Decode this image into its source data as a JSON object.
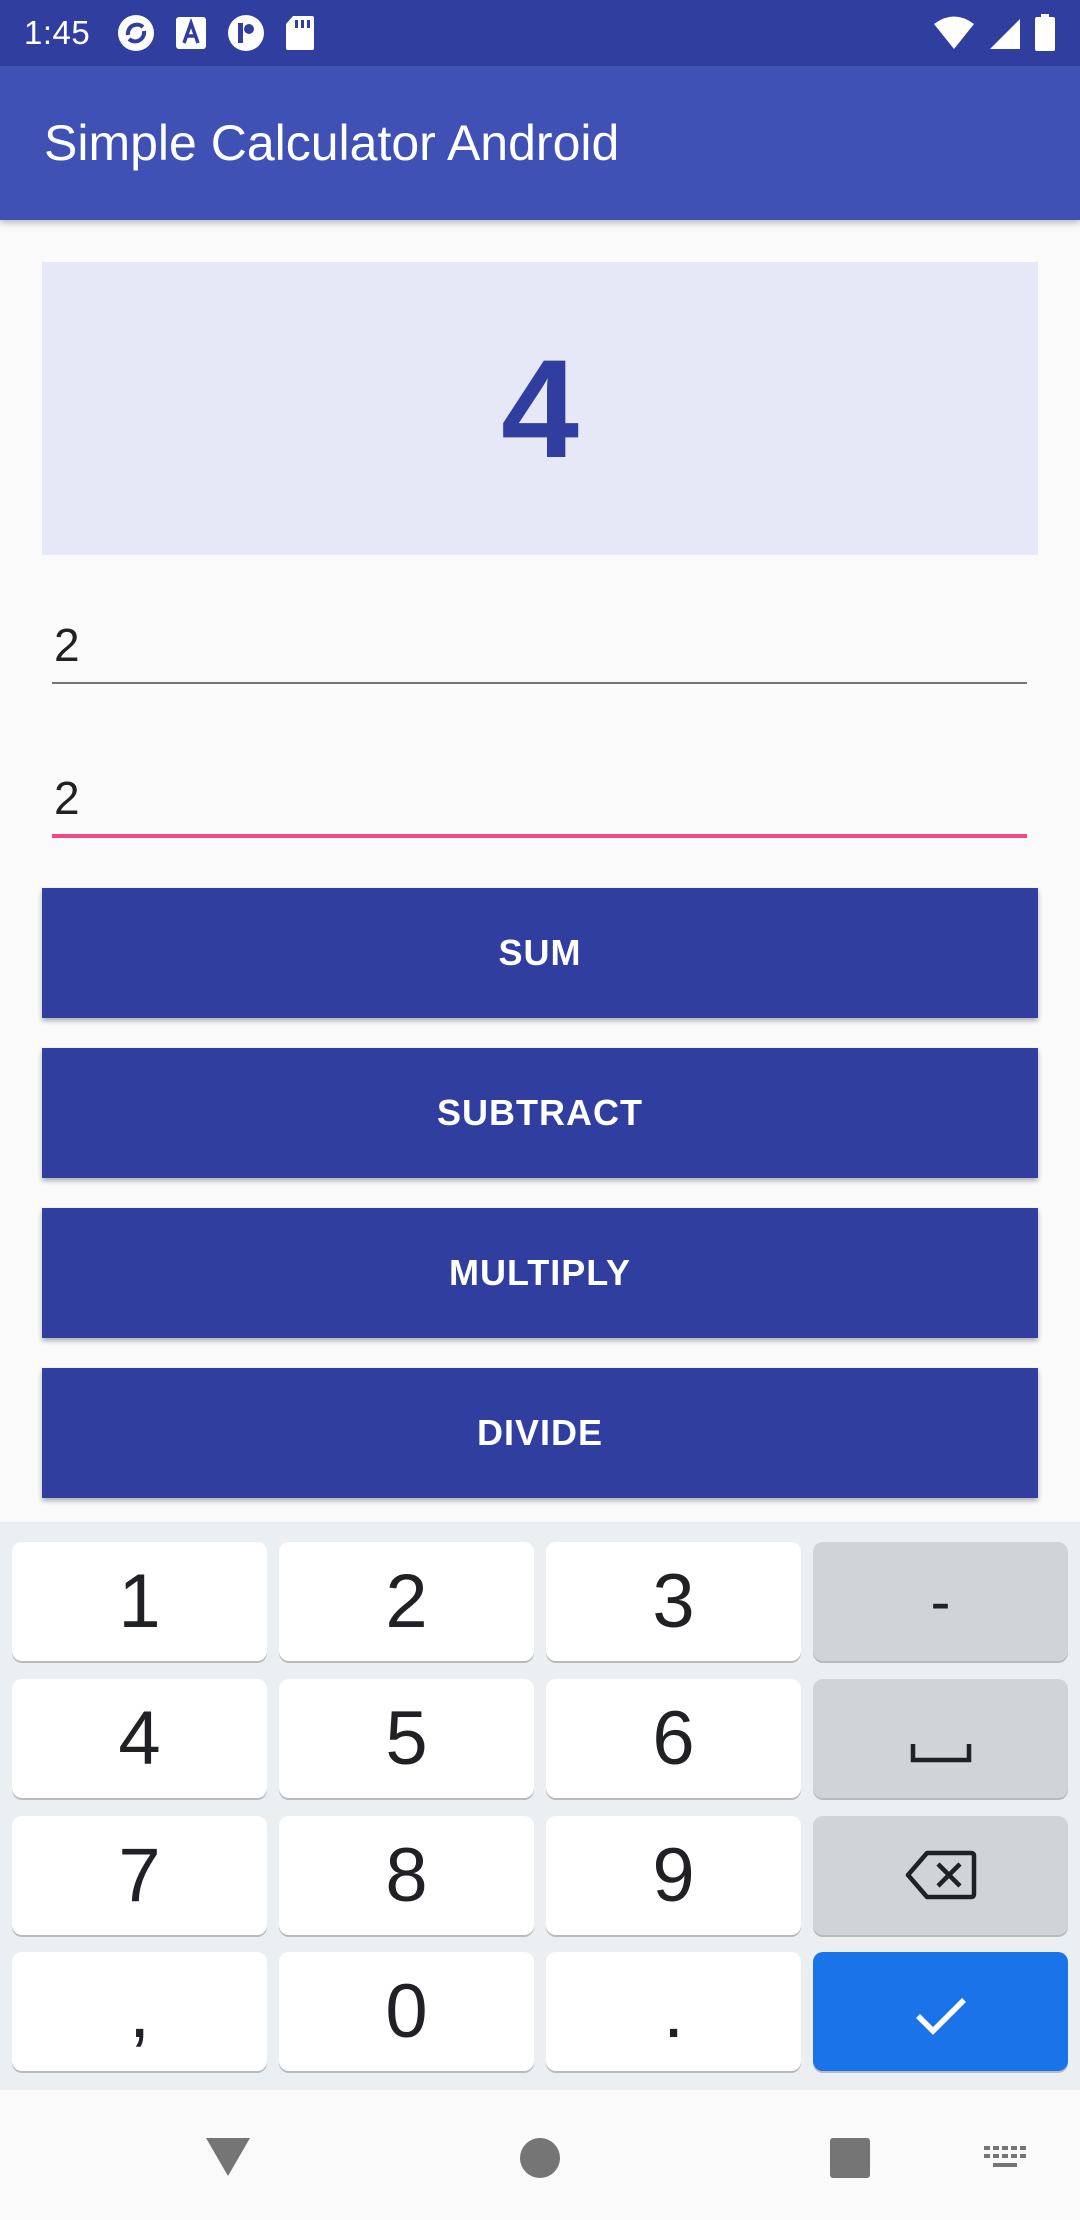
{
  "status_bar": {
    "time": "1:45",
    "left_icons": [
      "sync-app-icon",
      "a-box-app-icon",
      "p-circle-app-icon",
      "sd-card-icon"
    ],
    "right_icons": [
      "wifi-icon",
      "cell-signal-icon",
      "battery-icon"
    ]
  },
  "app_bar": {
    "title": "Simple Calculator Android"
  },
  "result": {
    "value": "4"
  },
  "inputs": {
    "first_value": "2",
    "second_value": "2"
  },
  "buttons": {
    "sum": "SUM",
    "subtract": "SUBTRACT",
    "multiply": "MULTIPLY",
    "divide": "DIVIDE"
  },
  "keyboard": {
    "rows": [
      [
        "1",
        "2",
        "3",
        "-"
      ],
      [
        "4",
        "5",
        "6",
        "space"
      ],
      [
        "7",
        "8",
        "9",
        "backspace"
      ],
      [
        ",",
        "0",
        ".",
        "done"
      ]
    ],
    "labels": {
      "k1": "1",
      "k2": "2",
      "k3": "3",
      "minus": "-",
      "k4": "4",
      "k5": "5",
      "k6": "6",
      "k7": "7",
      "k8": "8",
      "k9": "9",
      "comma": ",",
      "k0": "0",
      "period": "."
    },
    "special_keys": [
      "space-icon",
      "backspace-icon",
      "checkmark-icon"
    ]
  },
  "nav_bar": {
    "icons": [
      "back-icon",
      "home-icon",
      "recents-icon",
      "keyboard-switch-icon"
    ]
  },
  "colors": {
    "status_bar": "#303f9f",
    "app_bar": "#3f51b5",
    "primary_dark": "#303f9f",
    "result_panel": "#e6e8f7",
    "accent": "#f44785",
    "enter_key": "#1a73e8"
  }
}
